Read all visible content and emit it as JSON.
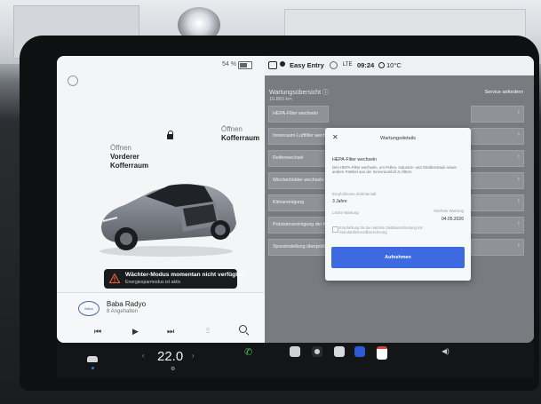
{
  "car_pane": {
    "battery_percent": "54 %",
    "front_trunk": {
      "action": "Öffnen",
      "name_line1": "Vorderer",
      "name_line2": "Kofferraum"
    },
    "rear_trunk": {
      "action": "Öffnen",
      "name": "Kofferraum"
    },
    "sentry_alert": {
      "title": "Wächter-Modus momentan nicht verfügbar",
      "subtitle": "Energiesparmodus ist aktiv"
    }
  },
  "media": {
    "logo_text": "Baba",
    "station": "Baba Radyo",
    "subtitle": "8 Angehalten",
    "controls": {
      "prev": "⏮",
      "play": "▶",
      "next": "⏭",
      "equalizer": "⫶⫶"
    }
  },
  "status_bar": {
    "profile": "Easy Entry",
    "network": "LTE",
    "time": "09:24",
    "outside_temp": "10°C"
  },
  "service": {
    "title": "Wartungsübersicht ⓘ",
    "distance": "10.883 km",
    "link": "Service anfordern",
    "tasks": [
      "HEPA-Filter wechseln",
      "Innenraum-Luftfilter wechseln",
      "Reifenwechsel",
      "Wischerblätter wechseln",
      "Klimareinigung",
      "Präzisionsreinigung der Kondensation",
      "Spureinstellung überprüfen"
    ]
  },
  "dialog": {
    "close": "✕",
    "title": "Wartungsdetails",
    "task": "HEPA-Filter wechseln",
    "description": "Den HEPA-Filter wechseln, um Pollen, Industrie- und Straßenstaub sowie andere Partikel aus der Innenraumluft zu filtern.",
    "interval_label": "Empfohlenes Zeitintervall",
    "interval_value": "3 Jahre",
    "last_label": "Letzte Wartung",
    "next_label": "Nächste Wartung",
    "next_date": "04.05.2026",
    "checkbox_text": "Empfehlung für die nächste Zeitüberschreitung mit Standardintervallberechnung",
    "button": "Aufnehmen"
  },
  "dock": {
    "cabin_temp": "22.0",
    "left_chevron": "‹",
    "right_chevron": "›",
    "fan": "⚙",
    "phone": "✆",
    "volume": "◀)"
  },
  "colors": {
    "accent_blue": "#3e6ae1",
    "dock_bg": "#141517",
    "warning": "#e05a3a"
  }
}
